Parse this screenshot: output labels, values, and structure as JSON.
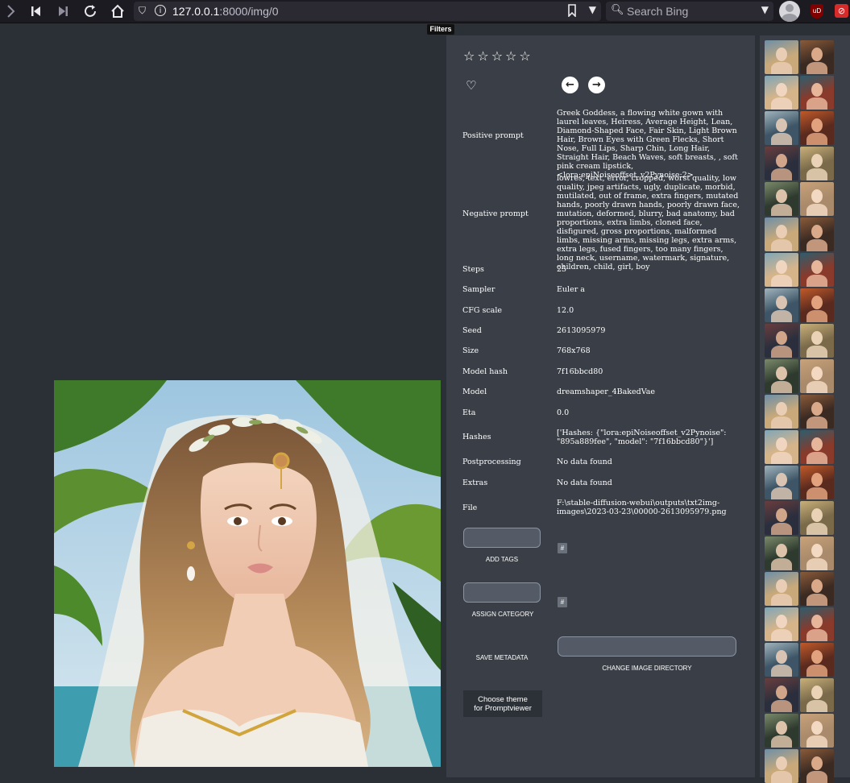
{
  "browser": {
    "url_host": "127.0.0.1",
    "url_rest": ":8000/img/0",
    "search_placeholder": "Search Bing",
    "ublock_badge": "uD"
  },
  "tooltip": "Filters",
  "rating": {
    "stars": "☆☆☆☆☆",
    "filled": 0,
    "max": 5
  },
  "metadata": {
    "rows": [
      {
        "label": "Positive prompt",
        "value": "Greek Goddess, a flowing white gown with laurel leaves, Heiress, Average Height, Lean, Diamond-Shaped Face, Fair Skin, Light Brown Hair, Brown Eyes with Green Flecks, Short Nose, Full Lips, Sharp Chin, Long Hair, Straight Hair, Beach Waves, soft breasts, , soft pink cream lipstick, <lora:epiNoiseoffset_v2Pynoise:2>"
      },
      {
        "label": "Negative prompt",
        "value": "lowres, text, error, cropped, worst quality, low quality, jpeg artifacts, ugly, duplicate, morbid, mutilated, out of frame, extra fingers, mutated hands, poorly drawn hands, poorly drawn face, mutation, deformed, blurry, bad anatomy, bad proportions, extra limbs, cloned face, disfigured, gross proportions, malformed limbs, missing arms, missing legs, extra arms, extra legs, fused fingers, too many fingers, long neck, username, watermark, signature, children, child, girl, boy"
      },
      {
        "label": "Steps",
        "value": "25"
      },
      {
        "label": "Sampler",
        "value": "Euler a"
      },
      {
        "label": "CFG scale",
        "value": "12.0"
      },
      {
        "label": "Seed",
        "value": "2613095979"
      },
      {
        "label": "Size",
        "value": "768x768"
      },
      {
        "label": "Model hash",
        "value": "7f16bbcd80"
      },
      {
        "label": "Model",
        "value": "dreamshaper_4BakedVae"
      },
      {
        "label": "Eta",
        "value": "0.0"
      },
      {
        "label": "Hashes",
        "value": "['Hashes: {\"lora:epiNoiseoffset_v2Pynoise\": \"895a889fee\", \"model\": \"7f16bbcd80\"}']"
      },
      {
        "label": "Postprocessing",
        "value": "No data found"
      },
      {
        "label": "Extras",
        "value": "No data found"
      },
      {
        "label": "File",
        "value": "F:\\stable-diffusion-webui\\outputs\\txt2img-images\\2023-03-23\\00000-2613095979.png"
      }
    ]
  },
  "actions": {
    "add_tags": "ADD TAGS",
    "assign_category": "ASSIGN CATEGORY",
    "hash_symbol": "#",
    "save_metadata": "SAVE METADATA",
    "change_image_directory": "CHANGE IMAGE DIRECTORY",
    "choose_theme_line1": "Choose theme",
    "choose_theme_line2": "for Promptviewer"
  },
  "colors": {
    "page_bg": "#2b3036",
    "panel_bg": "#3a3f47",
    "input_bg": "#545b67",
    "toolbar_bg": "#1c1b22"
  }
}
